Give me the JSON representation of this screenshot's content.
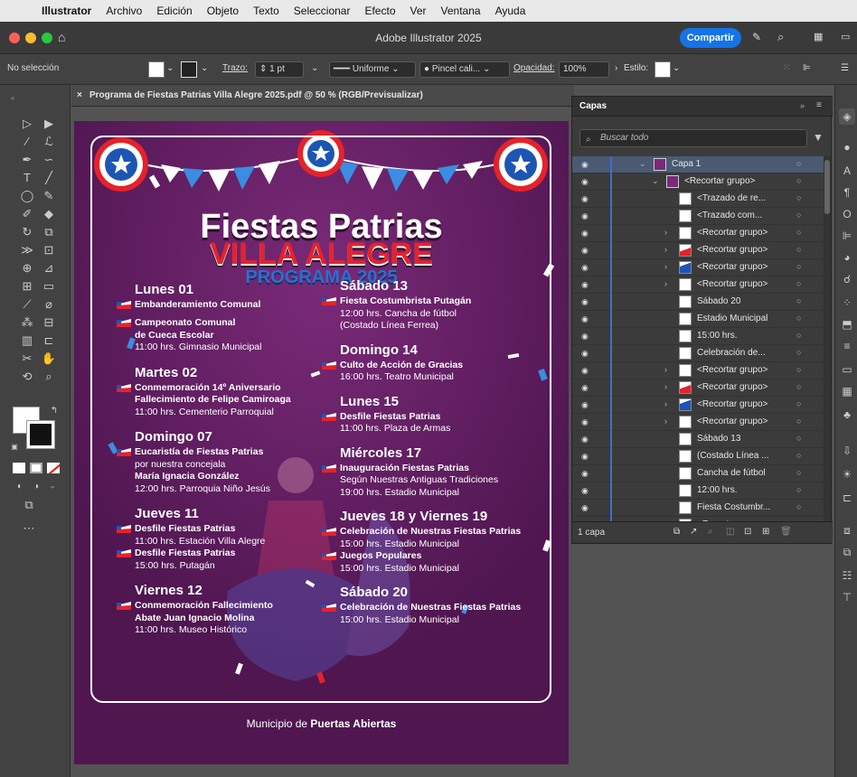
{
  "menubar": {
    "apple_icon": "apple-icon",
    "items": [
      "Illustrator",
      "Archivo",
      "Edición",
      "Objeto",
      "Texto",
      "Seleccionar",
      "Efecto",
      "Ver",
      "Ventana",
      "Ayuda"
    ]
  },
  "titlebar": {
    "title": "Adobe Illustrator 2025",
    "share": "Compartir"
  },
  "control": {
    "selection": "No selección",
    "stroke_label": "Trazo:",
    "stroke_value": "1 pt",
    "profile": "Uniforme",
    "brush": "Pincel cali...",
    "opacity_label": "Opacidad:",
    "opacity_value": "100%",
    "style_label": "Estilo:"
  },
  "document": {
    "tab": "Programa de Fiestas Patrias Villa Alegre 2025.pdf @ 50 % (RGB/Previsualizar)"
  },
  "poster": {
    "title1": "Fiestas Patrias",
    "title2": "VILLA ALEGRE",
    "title3": "PROGRAMA 2025",
    "footer_prefix": "Municipio de ",
    "footer_bold": "Puertas Abiertas",
    "left": [
      {
        "day": "Lunes 01",
        "lines": [
          {
            "t": "Embanderamiento Comunal",
            "b": true,
            "flag": true
          },
          {
            "t": "Campeonato Comunal",
            "b": true,
            "flag": true
          },
          {
            "t": "de Cueca Escolar",
            "b": true
          },
          {
            "t": "11:00 hrs. Gimnasio Municipal",
            "b": false
          }
        ]
      },
      {
        "day": "Martes 02",
        "lines": [
          {
            "t": "Conmemoración 14º Aniversario",
            "b": true,
            "flag": true
          },
          {
            "t": "Fallecimiento de Felipe Camiroaga",
            "b": true
          },
          {
            "t": "11:00 hrs.  Cementerio Parroquial",
            "b": false
          }
        ]
      },
      {
        "day": "Domingo 07",
        "lines": [
          {
            "t": "Eucaristía de Fiestas Patrias",
            "b": true,
            "flag": true
          },
          {
            "t": "por nuestra concejala",
            "b": false
          },
          {
            "t": "María Ignacia González",
            "b": true
          },
          {
            "t": "12:00 hrs. Parroquia Niño Jesús",
            "b": false
          }
        ]
      },
      {
        "day": "Jueves 11",
        "lines": [
          {
            "t": "Desfile Fiestas Patrias",
            "b": true,
            "flag": true
          },
          {
            "t": "11:00 hrs.  Estación Villa Alegre",
            "b": false
          },
          {
            "t": "Desfile Fiestas Patrias",
            "b": true,
            "flag": true
          },
          {
            "t": "15:00 hrs. Putagán",
            "b": false
          }
        ]
      },
      {
        "day": "Viernes 12",
        "lines": [
          {
            "t": "Conmemoración Fallecimiento",
            "b": true,
            "flag": true
          },
          {
            "t": "Abate Juan Ignacio Molina",
            "b": true
          },
          {
            "t": "11:00 hrs. Museo Histórico",
            "b": false
          }
        ]
      }
    ],
    "right": [
      {
        "day": "Sábado 13",
        "lines": [
          {
            "t": "Fiesta Costumbrista Putagán",
            "b": true,
            "flag": true
          },
          {
            "t": "12:00 hrs. Cancha de fútbol",
            "b": false
          },
          {
            "t": "(Costado Línea Ferrea)",
            "b": false
          }
        ]
      },
      {
        "day": "Domingo 14",
        "lines": [
          {
            "t": "Culto de Acción de Gracias",
            "b": true,
            "flag": true
          },
          {
            "t": "16:00 hrs. Teatro Municipal",
            "b": false
          }
        ]
      },
      {
        "day": "Lunes 15",
        "lines": [
          {
            "t": "Desfile Fiestas Patrias",
            "b": true,
            "flag": true
          },
          {
            "t": "11:00 hrs. Plaza de Armas",
            "b": false
          }
        ]
      },
      {
        "day": "Miércoles 17",
        "lines": [
          {
            "t": "Inauguración Fiestas Patrias",
            "b": true,
            "flag": true
          },
          {
            "t": "Según Nuestras Antiguas Tradiciones",
            "b": false
          },
          {
            "t": "19:00 hrs.  Estadio Municipal",
            "b": false
          }
        ]
      },
      {
        "day": "Jueves 18 y Viernes 19",
        "lines": [
          {
            "t": "Celebración de Nuestras Fiestas Patrias",
            "b": true,
            "flag": true
          },
          {
            "t": "15:00 hrs. Estadio Municipal",
            "b": false
          },
          {
            "t": "Juegos Populares",
            "b": true,
            "flag": true
          },
          {
            "t": "15:00 hrs. Estadio Municipal",
            "b": false
          }
        ]
      },
      {
        "day": "Sábado 20",
        "lines": [
          {
            "t": "Celebración de Nuestras Fiestas Patrias",
            "b": true,
            "flag": true
          },
          {
            "t": "15:00 hrs. Estadio Municipal",
            "b": false
          }
        ]
      }
    ]
  },
  "layers": {
    "tab": "Capas",
    "search": "Buscar todo",
    "footer_count": "1 capa",
    "rows": [
      {
        "label": "Capa 1",
        "indent": 0,
        "twisty": "open",
        "thumb": "layer"
      },
      {
        "label": "<Recortar grupo>",
        "indent": 1,
        "twisty": "open",
        "thumb": "layer"
      },
      {
        "label": "<Trazado de re...",
        "indent": 2,
        "twisty": "",
        "thumb": "white"
      },
      {
        "label": "<Trazado com...",
        "indent": 2,
        "twisty": "",
        "thumb": "white"
      },
      {
        "label": "<Recortar grupo>",
        "indent": 2,
        "twisty": "closed",
        "thumb": "white"
      },
      {
        "label": "<Recortar grupo>",
        "indent": 2,
        "twisty": "closed",
        "thumb": "red"
      },
      {
        "label": "<Recortar grupo>",
        "indent": 2,
        "twisty": "closed",
        "thumb": "blue"
      },
      {
        "label": "<Recortar grupo>",
        "indent": 2,
        "twisty": "closed",
        "thumb": "white"
      },
      {
        "label": "Sábado 20",
        "indent": 2,
        "twisty": "",
        "thumb": "white"
      },
      {
        "label": "Estadio Municipal",
        "indent": 2,
        "twisty": "",
        "thumb": "white"
      },
      {
        "label": "15:00 hrs.",
        "indent": 2,
        "twisty": "",
        "thumb": "white"
      },
      {
        "label": "Celebración de...",
        "indent": 2,
        "twisty": "",
        "thumb": "white"
      },
      {
        "label": "<Recortar grupo>",
        "indent": 2,
        "twisty": "closed",
        "thumb": "white"
      },
      {
        "label": "<Recortar grupo>",
        "indent": 2,
        "twisty": "closed",
        "thumb": "red"
      },
      {
        "label": "<Recortar grupo>",
        "indent": 2,
        "twisty": "closed",
        "thumb": "blue"
      },
      {
        "label": "<Recortar grupo>",
        "indent": 2,
        "twisty": "closed",
        "thumb": "white"
      },
      {
        "label": "Sábado 13",
        "indent": 2,
        "twisty": "",
        "thumb": "white"
      },
      {
        "label": "(Costado Línea ...",
        "indent": 2,
        "twisty": "",
        "thumb": "white"
      },
      {
        "label": "Cancha de fútbol",
        "indent": 2,
        "twisty": "",
        "thumb": "white"
      },
      {
        "label": "12:00 hrs.",
        "indent": 2,
        "twisty": "",
        "thumb": "white"
      },
      {
        "label": "Fiesta Costumbr...",
        "indent": 2,
        "twisty": "",
        "thumb": "white"
      },
      {
        "label": "<Recortar grupo>",
        "indent": 2,
        "twisty": "closed",
        "thumb": "white"
      }
    ]
  },
  "colors": {
    "accent": "#1473e6",
    "poster_bg": "#5b1c59",
    "red": "#e5222a",
    "blue": "#2b6fd1"
  }
}
